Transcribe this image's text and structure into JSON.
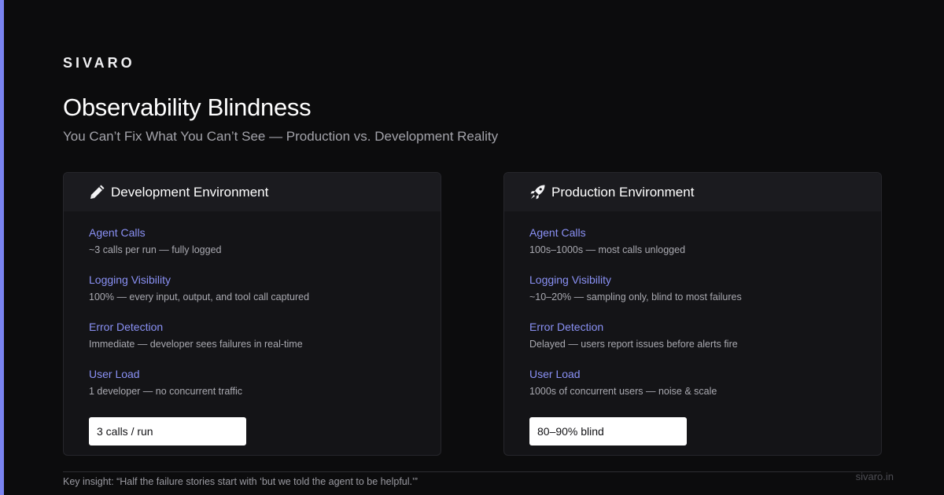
{
  "brand": "SIVARO",
  "title": "Observability Blindness",
  "subtitle": "You Can’t Fix What You Can’t See — Production vs. Development Reality",
  "colors": {
    "accent": "#7a83f0",
    "label": "#8a91f5",
    "background": "#0c0c0d",
    "card": "#141417"
  },
  "cards": [
    {
      "icon": "pencil-icon",
      "title": "Development Environment",
      "rows": [
        {
          "label": "Agent Calls",
          "value": "~3 calls per run — fully logged"
        },
        {
          "label": "Logging Visibility",
          "value": "100% — every input, output, and tool call captured"
        },
        {
          "label": "Error Detection",
          "value": "Immediate — developer sees failures in real-time"
        },
        {
          "label": "User Load",
          "value": "1 developer — no concurrent traffic"
        }
      ],
      "pill": "3 calls / run"
    },
    {
      "icon": "rocket-icon",
      "title": "Production Environment",
      "rows": [
        {
          "label": "Agent Calls",
          "value": "100s–1000s — most calls unlogged"
        },
        {
          "label": "Logging Visibility",
          "value": "~10–20% — sampling only, blind to most failures"
        },
        {
          "label": "Error Detection",
          "value": "Delayed — users report issues before alerts fire"
        },
        {
          "label": "User Load",
          "value": "1000s of concurrent users — noise & scale"
        }
      ],
      "pill": "80–90% blind"
    }
  ],
  "footer": {
    "note": "Key insight: “Half the failure stories start with ‘but we told the agent to be helpful.’”",
    "url": "sivaro.in"
  }
}
